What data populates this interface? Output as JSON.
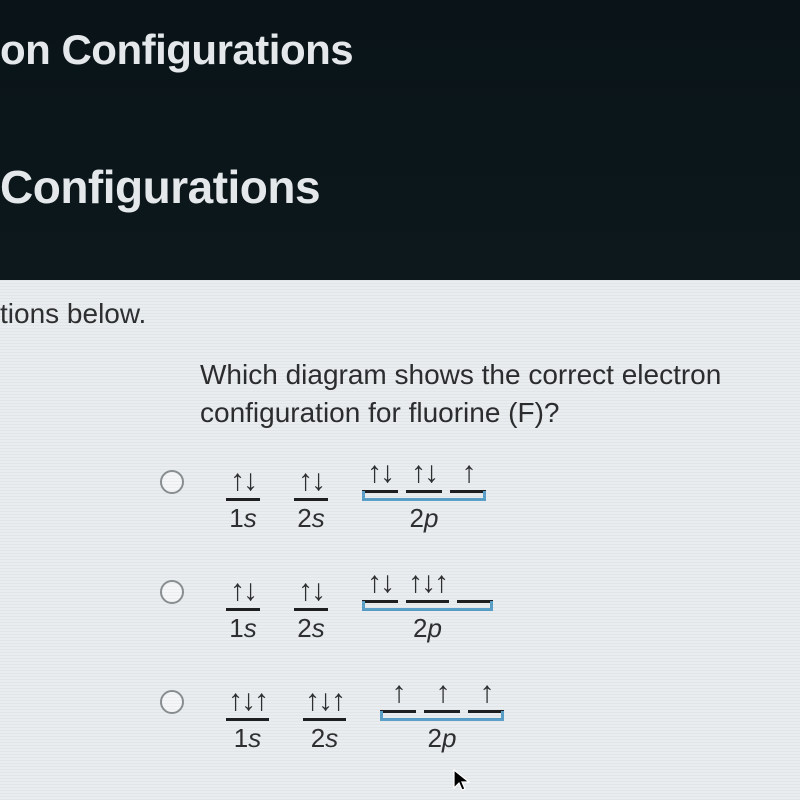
{
  "header": {
    "title_fragment_1": "on Configurations",
    "title_fragment_2": "Configurations"
  },
  "content": {
    "instruction_fragment": "tions below.",
    "question": "Which diagram shows the correct electron configuration for fluorine (F)?"
  },
  "options": [
    {
      "orbitals": [
        {
          "fill": "↑↓",
          "label": "1s"
        },
        {
          "fill": "↑↓",
          "label": "2s"
        }
      ],
      "p_group": {
        "fills": [
          "↑↓",
          "↑↓",
          "↑"
        ],
        "label": "2p"
      }
    },
    {
      "orbitals": [
        {
          "fill": "↑↓",
          "label": "1s"
        },
        {
          "fill": "↑↓",
          "label": "2s"
        }
      ],
      "p_group": {
        "fills": [
          "↑↓",
          "↑↓↑",
          ""
        ],
        "label": "2p"
      }
    },
    {
      "orbitals": [
        {
          "fill": "↑↓↑",
          "label": "1s"
        },
        {
          "fill": "↑↓↑",
          "label": "2s"
        }
      ],
      "p_group": {
        "fills": [
          "↑",
          "↑",
          "↑"
        ],
        "label": "2p"
      }
    }
  ]
}
